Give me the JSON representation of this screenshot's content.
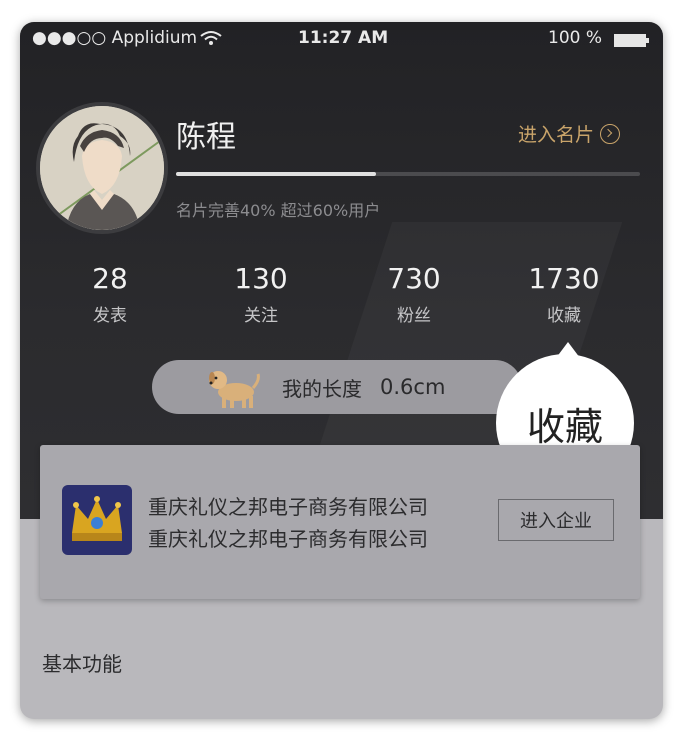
{
  "status_bar": {
    "carrier": "●●●○○ Applidium",
    "time": "11:27 AM",
    "battery": "100 %"
  },
  "profile": {
    "name": "陈程",
    "enter_card_label": "进入名片",
    "progress_text": "名片完善40%  超过60%用户",
    "progress_fraction": 0.43
  },
  "stats": [
    {
      "value": "28",
      "label": "发表"
    },
    {
      "value": "130",
      "label": "关注"
    },
    {
      "value": "730",
      "label": "粉丝"
    },
    {
      "value": "1730",
      "label": "收藏"
    }
  ],
  "length": {
    "label": "我的长度",
    "value": "0.6cm"
  },
  "tooltip": {
    "text": "收藏"
  },
  "company": {
    "name_line1": "重庆礼仪之邦电子商务有限公司",
    "name_line2": "重庆礼仪之邦电子商务有限公司",
    "button_label": "进入企业"
  },
  "section": {
    "title": "基本功能"
  },
  "colors": {
    "accent": "#c9a46a",
    "dark_bg": "#2a2a2d",
    "overlay_bg": "#b9b8bc"
  },
  "icons": [
    "wifi-icon",
    "battery-icon",
    "chevron-right-circle-icon",
    "dog-icon",
    "crown-logo"
  ]
}
